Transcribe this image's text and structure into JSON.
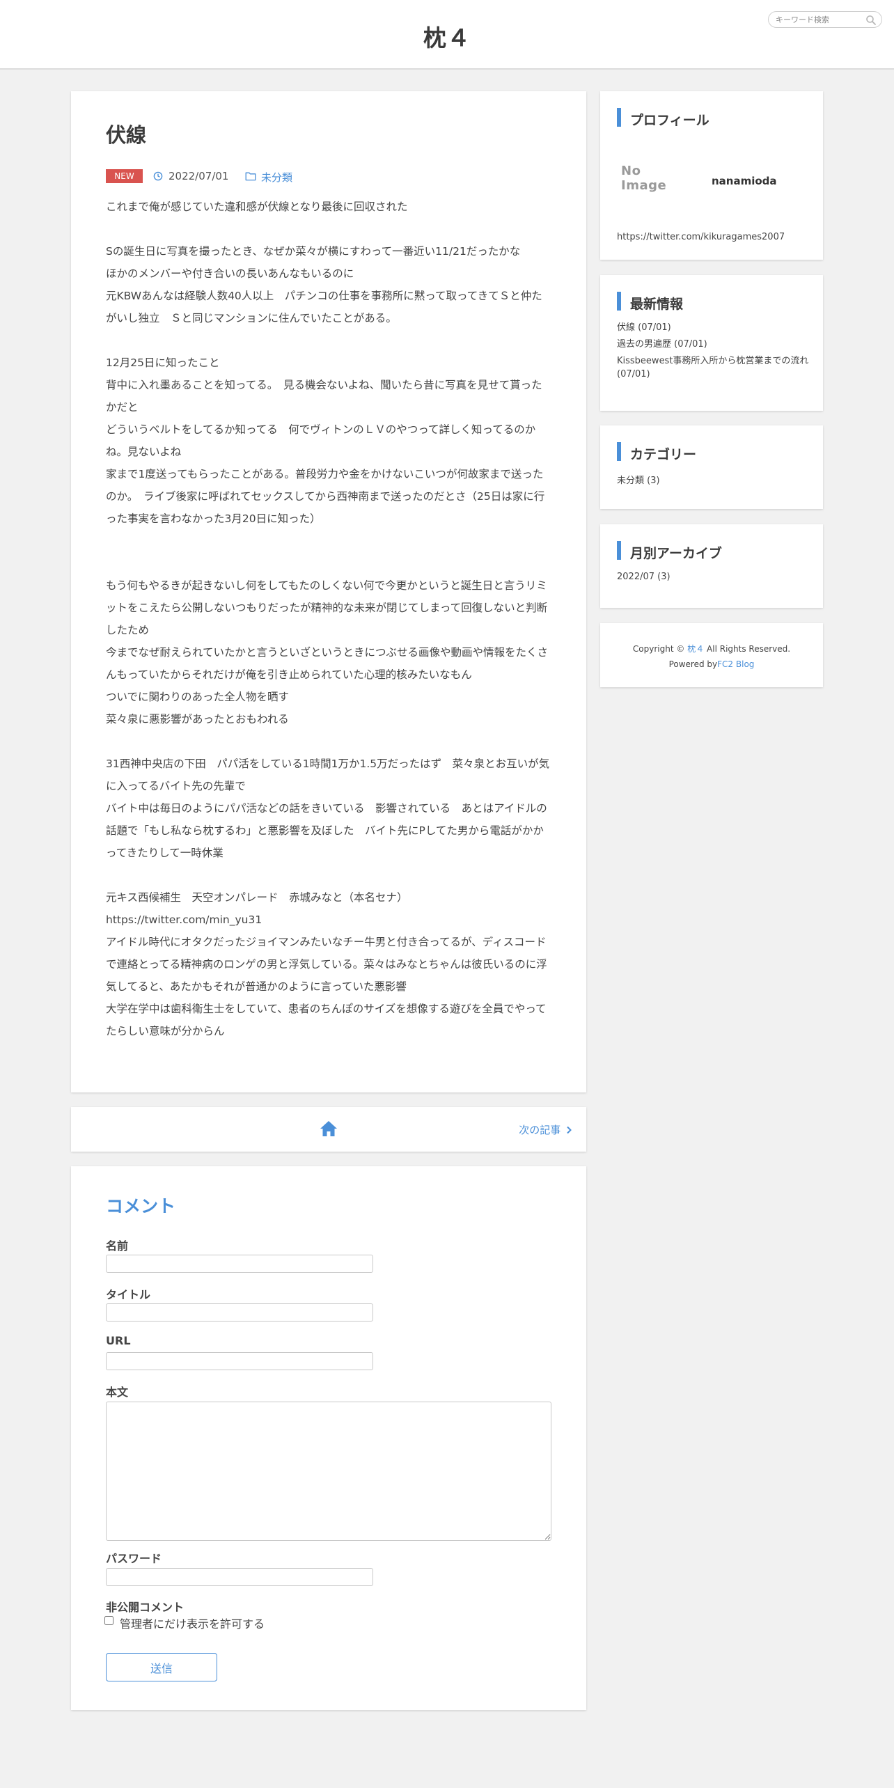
{
  "site": {
    "title": "枕４",
    "search_placeholder": "キーワード検索"
  },
  "article": {
    "title": "伏線",
    "badge": "NEW",
    "date": "2022/07/01",
    "category": "未分類",
    "paragraphs": [
      "これまで俺が感じていた違和感が伏線となり最後に回収された",
      "",
      "Sの誕生日に写真を撮ったとき、なぜか菜々が横にすわって一番近い11/21だったかな",
      "ほかのメンバーや付き合いの長いあんなもいるのに",
      "元KBWあんなは経験人数40人以上　パチンコの仕事を事務所に黙って取ってきてＳと仲たがいし独立　Ｓと同じマンションに住んでいたことがある。",
      "",
      "12月25日に知ったこと",
      "背中に入れ墨あることを知ってる。　見る機会ないよね、聞いたら昔に写真を見せて貰ったかだと",
      "どういうベルトをしてるか知ってる　何でヴィトンのＬＶのやつって詳しく知ってるのかね。見ないよね",
      "家まで1度送ってもらったことがある。普段労力や金をかけないこいつが何故家まで送ったのか。　ライブ後家に呼ばれてセックスしてから西神南まで送ったのだとさ（25日は家に行った事実を言わなかった3月20日に知った）",
      "",
      "",
      "もう何もやるきが起きないし何をしてもたのしくない何で今更かというと誕生日と言うリミットをこえたら公開しないつもりだったが精神的な未来が閉じてしまって回復しないと判断したため",
      "今までなぜ耐えられていたかと言うといざというときにつぶせる画像や動画や情報をたくさんもっていたからそれだけが俺を引き止められていた心理的核みたいなもん",
      "ついでに関わりのあった全人物を晒す",
      "菜々泉に悪影響があったとおもわれる",
      "",
      "31西神中央店の下田　パパ活をしている1時間1万か1.5万だったはず　菜々泉とお互いが気に入ってるバイト先の先輩で",
      "バイト中は毎日のようにパパ活などの話をきいている　影響されている　あとはアイドルの話題で「もし私なら枕するわ」と悪影響を及ぼした　バイト先にPしてた男から電話がかかってきたりして一時休業",
      "",
      "元キス西候補生　天空オンパレード　赤城みなと（本名セナ）",
      "https://twitter.com/min_yu31",
      "アイドル時代にオタクだったジョイマンみたいなチー牛男と付き合ってるが、ディスコードで連絡とってる精神病のロンゲの男と浮気している。菜々はみなとちゃんは彼氏いるのに浮気してると、あたかもそれが普通かのように言っていた悪影響",
      "大学在学中は歯科衛生士をしていて、患者のちんぽのサイズを想像する遊びを全員でやってたらしい意味が分からん"
    ]
  },
  "nav": {
    "next_label": "次の記事",
    "home_icon": "home-icon"
  },
  "comment_form": {
    "title": "コメント",
    "name_label": "名前",
    "title_label": "タイトル",
    "url_label": "URL",
    "body_label": "本文",
    "password_label": "パスワード",
    "private_label": "非公開コメント",
    "private_check": "管理者にだけ表示を許可する",
    "submit": "送信"
  },
  "sidebar": {
    "profile": {
      "heading": "プロフィール",
      "noimage": "No Image",
      "username": "nanamioda",
      "twitter": "https://twitter.com/kikuragames2007"
    },
    "recent": {
      "heading": "最新情報",
      "items": [
        "伏線 (07/01)",
        "過去の男遍歴 (07/01)",
        "Kissbeewest事務所入所から枕営業までの流れ (07/01)"
      ]
    },
    "categories": {
      "heading": "カテゴリー",
      "items": [
        "未分類 (3)"
      ]
    },
    "archives": {
      "heading": "月別アーカイブ",
      "items": [
        "2022/07 (3)"
      ]
    },
    "footer": {
      "copyright_prefix": "Copyright ©",
      "site_link": "枕４",
      "rights": "All Rights Reserved.",
      "powered_prefix": "Powered by",
      "powered_link": "FC2 Blog"
    }
  },
  "colors": {
    "accent": "#4a8fd8",
    "badge": "#d9534f",
    "background": "#f1f1f1"
  }
}
